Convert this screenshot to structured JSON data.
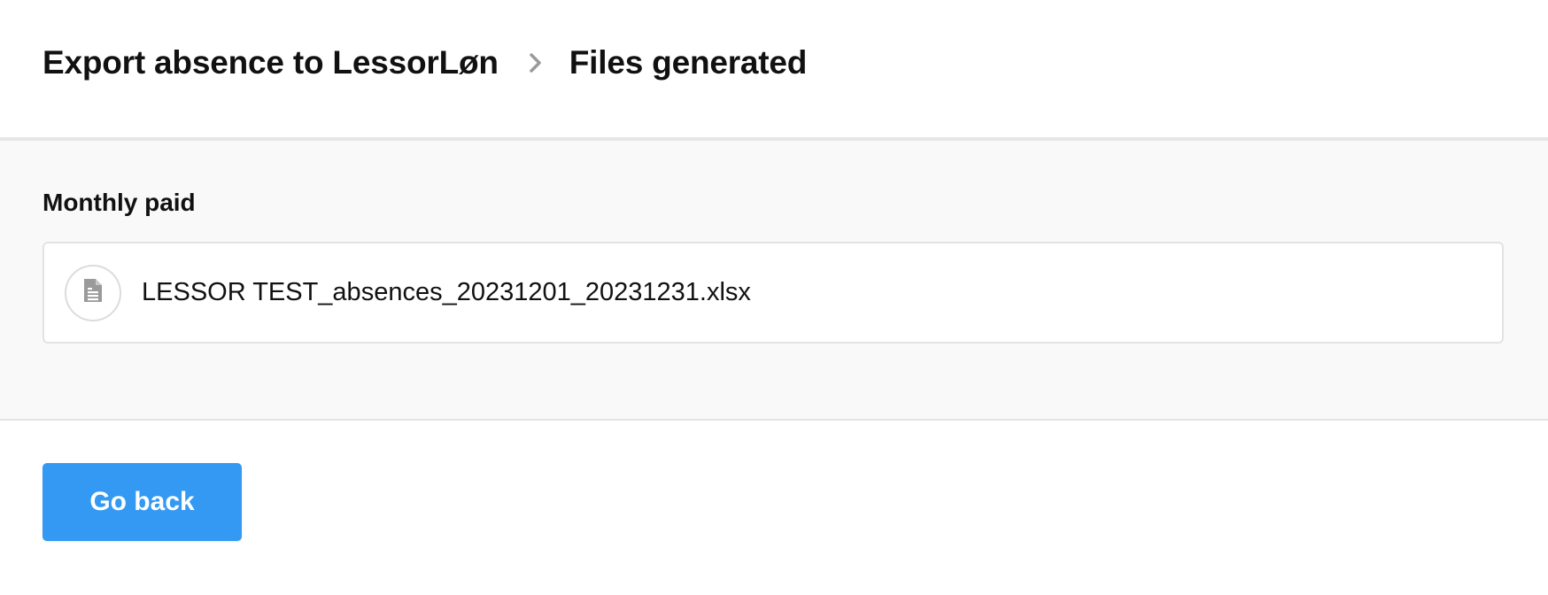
{
  "breadcrumb": {
    "parent": "Export absence to LessorLøn",
    "separator_icon": "chevron-right-icon",
    "current": "Files generated"
  },
  "sections": [
    {
      "title": "Monthly paid",
      "files": [
        {
          "icon": "document-icon",
          "name": "LESSOR TEST_absences_20231201_20231231.xlsx"
        }
      ]
    }
  ],
  "footer": {
    "go_back_label": "Go back"
  },
  "colors": {
    "primary_button": "#3399f3",
    "content_background": "#f9f9f9",
    "border": "#e3e3e3",
    "separator": "#9a9a9a",
    "icon": "#9a9a9a"
  }
}
